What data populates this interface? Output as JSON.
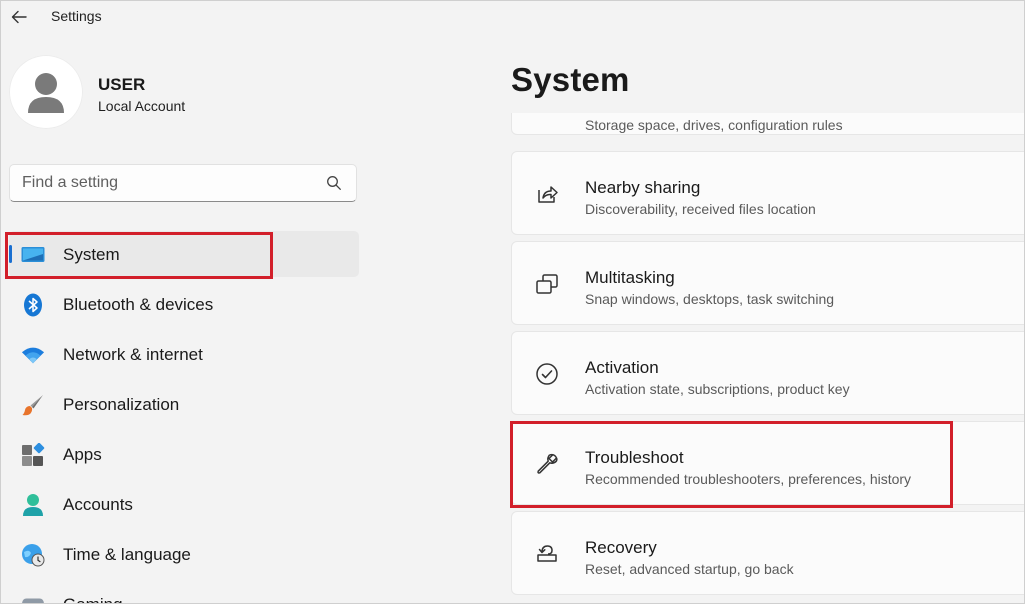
{
  "window": {
    "title": "Settings"
  },
  "user": {
    "name": "USER",
    "account_type": "Local Account"
  },
  "search": {
    "placeholder": "Find a setting",
    "value": ""
  },
  "sidebar": {
    "items": [
      {
        "label": "System",
        "icon": "system-monitor-icon",
        "selected": true
      },
      {
        "label": "Bluetooth & devices",
        "icon": "bluetooth-icon",
        "selected": false
      },
      {
        "label": "Network & internet",
        "icon": "wifi-icon",
        "selected": false
      },
      {
        "label": "Personalization",
        "icon": "paintbrush-icon",
        "selected": false
      },
      {
        "label": "Apps",
        "icon": "apps-icon",
        "selected": false
      },
      {
        "label": "Accounts",
        "icon": "accounts-icon",
        "selected": false
      },
      {
        "label": "Time & language",
        "icon": "globe-clock-icon",
        "selected": false
      },
      {
        "label": "Gaming",
        "icon": "gamepad-icon",
        "selected": false
      }
    ]
  },
  "main": {
    "title": "System",
    "partial_card": {
      "description": "Storage space, drives, configuration rules"
    },
    "cards": [
      {
        "title": "Nearby sharing",
        "description": "Discoverability, received files location",
        "icon": "share-icon"
      },
      {
        "title": "Multitasking",
        "description": "Snap windows, desktops, task switching",
        "icon": "multitasking-icon"
      },
      {
        "title": "Activation",
        "description": "Activation state, subscriptions, product key",
        "icon": "activation-check-icon"
      },
      {
        "title": "Troubleshoot",
        "description": "Recommended troubleshooters, preferences, history",
        "icon": "wrench-icon"
      },
      {
        "title": "Recovery",
        "description": "Reset, advanced startup, go back",
        "icon": "recovery-icon"
      }
    ]
  },
  "colors": {
    "accent": "#1a6fd0",
    "highlight": "#d21f2a",
    "background": "#f3f3f3"
  }
}
